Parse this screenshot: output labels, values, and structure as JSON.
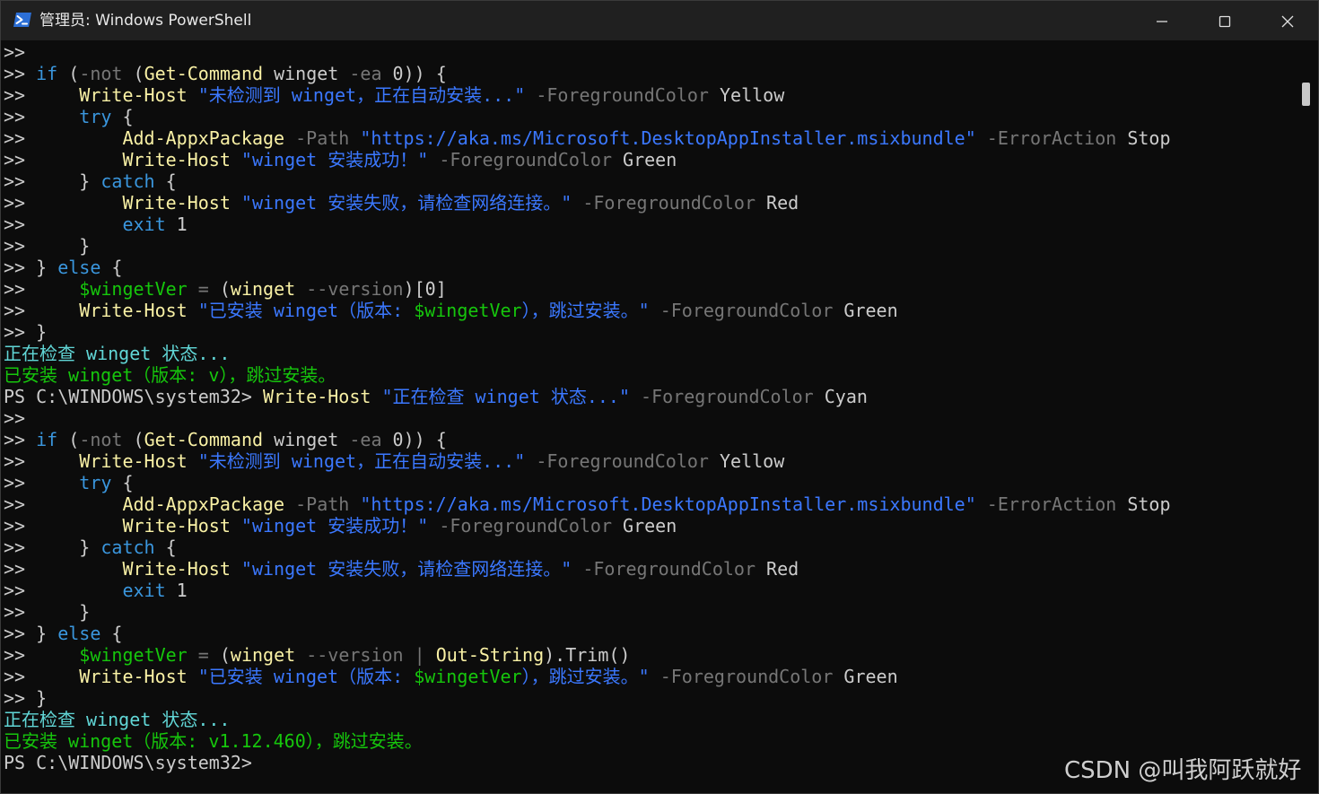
{
  "window": {
    "title": "管理员: Windows PowerShell",
    "app_icon": "powershell-icon",
    "controls": [
      "minimize-icon",
      "maximize-icon",
      "close-icon"
    ]
  },
  "colors": {
    "background": "#0c0c0c",
    "titlebar": "#202020",
    "command": "#f9f1a5",
    "keyword": "#3a96dd",
    "string": "#3b78ff",
    "parameter": "#767676",
    "variable": "#16c60c",
    "text": "#cccccc",
    "output_cyan": "#61d6d6",
    "output_green": "#16c60c"
  },
  "terminal": {
    "lines": [
      [
        [
          "text",
          ">>"
        ]
      ],
      [
        [
          "text",
          ">> "
        ],
        [
          "keyword",
          "if"
        ],
        [
          "text",
          " ("
        ],
        [
          "operator",
          "-not"
        ],
        [
          "text",
          " ("
        ],
        [
          "command",
          "Get-Command"
        ],
        [
          "text",
          " winget "
        ],
        [
          "param",
          "-ea"
        ],
        [
          "text",
          " 0)) {"
        ]
      ],
      [
        [
          "text",
          ">>     "
        ],
        [
          "command",
          "Write-Host"
        ],
        [
          "text",
          " "
        ],
        [
          "string",
          "\"未检测到 winget，正在自动安装...\""
        ],
        [
          "text",
          " "
        ],
        [
          "param",
          "-ForegroundColor"
        ],
        [
          "text",
          " Yellow"
        ]
      ],
      [
        [
          "text",
          ">>     "
        ],
        [
          "keyword",
          "try"
        ],
        [
          "text",
          " {"
        ]
      ],
      [
        [
          "text",
          ">>         "
        ],
        [
          "command",
          "Add-AppxPackage"
        ],
        [
          "text",
          " "
        ],
        [
          "param",
          "-Path"
        ],
        [
          "text",
          " "
        ],
        [
          "string",
          "\"https://aka.ms/Microsoft.DesktopAppInstaller.msixbundle\""
        ],
        [
          "text",
          " "
        ],
        [
          "param",
          "-ErrorAction"
        ],
        [
          "text",
          " Stop"
        ]
      ],
      [
        [
          "text",
          ">>         "
        ],
        [
          "command",
          "Write-Host"
        ],
        [
          "text",
          " "
        ],
        [
          "string",
          "\"winget 安装成功！\""
        ],
        [
          "text",
          " "
        ],
        [
          "param",
          "-ForegroundColor"
        ],
        [
          "text",
          " Green"
        ]
      ],
      [
        [
          "text",
          ">>     } "
        ],
        [
          "keyword",
          "catch"
        ],
        [
          "text",
          " {"
        ]
      ],
      [
        [
          "text",
          ">>         "
        ],
        [
          "command",
          "Write-Host"
        ],
        [
          "text",
          " "
        ],
        [
          "string",
          "\"winget 安装失败，请检查网络连接。\""
        ],
        [
          "text",
          " "
        ],
        [
          "param",
          "-ForegroundColor"
        ],
        [
          "text",
          " Red"
        ]
      ],
      [
        [
          "text",
          ">>         "
        ],
        [
          "keyword",
          "exit"
        ],
        [
          "text",
          " 1"
        ]
      ],
      [
        [
          "text",
          ">>     }"
        ]
      ],
      [
        [
          "text",
          ">> } "
        ],
        [
          "keyword",
          "else"
        ],
        [
          "text",
          " {"
        ]
      ],
      [
        [
          "text",
          ">>     "
        ],
        [
          "variable",
          "$wingetVer"
        ],
        [
          "text",
          " "
        ],
        [
          "operator",
          "="
        ],
        [
          "text",
          " ("
        ],
        [
          "command",
          "winget"
        ],
        [
          "text",
          " "
        ],
        [
          "param",
          "--version"
        ],
        [
          "text",
          ")[0]"
        ]
      ],
      [
        [
          "text",
          ">>     "
        ],
        [
          "command",
          "Write-Host"
        ],
        [
          "text",
          " "
        ],
        [
          "string",
          "\"已安装 winget（版本: "
        ],
        [
          "variable",
          "$wingetVer"
        ],
        [
          "string",
          "），跳过安装。\""
        ],
        [
          "text",
          " "
        ],
        [
          "param",
          "-ForegroundColor"
        ],
        [
          "text",
          " Green"
        ]
      ],
      [
        [
          "text",
          ">> }"
        ]
      ],
      [
        [
          "outcyan",
          "正在检查 winget 状态..."
        ]
      ],
      [
        [
          "outgreen",
          "已安装 winget（版本: v），跳过安装。"
        ]
      ],
      [
        [
          "text",
          "PS C:\\WINDOWS\\system32> "
        ],
        [
          "command",
          "Write-Host"
        ],
        [
          "text",
          " "
        ],
        [
          "string",
          "\"正在检查 winget 状态...\""
        ],
        [
          "text",
          " "
        ],
        [
          "param",
          "-ForegroundColor"
        ],
        [
          "text",
          " Cyan"
        ]
      ],
      [
        [
          "text",
          ">>"
        ]
      ],
      [
        [
          "text",
          ">> "
        ],
        [
          "keyword",
          "if"
        ],
        [
          "text",
          " ("
        ],
        [
          "operator",
          "-not"
        ],
        [
          "text",
          " ("
        ],
        [
          "command",
          "Get-Command"
        ],
        [
          "text",
          " winget "
        ],
        [
          "param",
          "-ea"
        ],
        [
          "text",
          " 0)) {"
        ]
      ],
      [
        [
          "text",
          ">>     "
        ],
        [
          "command",
          "Write-Host"
        ],
        [
          "text",
          " "
        ],
        [
          "string",
          "\"未检测到 winget，正在自动安装...\""
        ],
        [
          "text",
          " "
        ],
        [
          "param",
          "-ForegroundColor"
        ],
        [
          "text",
          " Yellow"
        ]
      ],
      [
        [
          "text",
          ">>     "
        ],
        [
          "keyword",
          "try"
        ],
        [
          "text",
          " {"
        ]
      ],
      [
        [
          "text",
          ">>         "
        ],
        [
          "command",
          "Add-AppxPackage"
        ],
        [
          "text",
          " "
        ],
        [
          "param",
          "-Path"
        ],
        [
          "text",
          " "
        ],
        [
          "string",
          "\"https://aka.ms/Microsoft.DesktopAppInstaller.msixbundle\""
        ],
        [
          "text",
          " "
        ],
        [
          "param",
          "-ErrorAction"
        ],
        [
          "text",
          " Stop"
        ]
      ],
      [
        [
          "text",
          ">>         "
        ],
        [
          "command",
          "Write-Host"
        ],
        [
          "text",
          " "
        ],
        [
          "string",
          "\"winget 安装成功！\""
        ],
        [
          "text",
          " "
        ],
        [
          "param",
          "-ForegroundColor"
        ],
        [
          "text",
          " Green"
        ]
      ],
      [
        [
          "text",
          ">>     } "
        ],
        [
          "keyword",
          "catch"
        ],
        [
          "text",
          " {"
        ]
      ],
      [
        [
          "text",
          ">>         "
        ],
        [
          "command",
          "Write-Host"
        ],
        [
          "text",
          " "
        ],
        [
          "string",
          "\"winget 安装失败，请检查网络连接。\""
        ],
        [
          "text",
          " "
        ],
        [
          "param",
          "-ForegroundColor"
        ],
        [
          "text",
          " Red"
        ]
      ],
      [
        [
          "text",
          ">>         "
        ],
        [
          "keyword",
          "exit"
        ],
        [
          "text",
          " 1"
        ]
      ],
      [
        [
          "text",
          ">>     }"
        ]
      ],
      [
        [
          "text",
          ">> } "
        ],
        [
          "keyword",
          "else"
        ],
        [
          "text",
          " {"
        ]
      ],
      [
        [
          "text",
          ">>     "
        ],
        [
          "variable",
          "$wingetVer"
        ],
        [
          "text",
          " "
        ],
        [
          "operator",
          "="
        ],
        [
          "text",
          " ("
        ],
        [
          "command",
          "winget"
        ],
        [
          "text",
          " "
        ],
        [
          "param",
          "--version"
        ],
        [
          "text",
          " "
        ],
        [
          "operator",
          "|"
        ],
        [
          "text",
          " "
        ],
        [
          "command",
          "Out-String"
        ],
        [
          "text",
          ").Trim()"
        ]
      ],
      [
        [
          "text",
          ">>     "
        ],
        [
          "command",
          "Write-Host"
        ],
        [
          "text",
          " "
        ],
        [
          "string",
          "\"已安装 winget（版本: "
        ],
        [
          "variable",
          "$wingetVer"
        ],
        [
          "string",
          "），跳过安装。\""
        ],
        [
          "text",
          " "
        ],
        [
          "param",
          "-ForegroundColor"
        ],
        [
          "text",
          " Green"
        ]
      ],
      [
        [
          "text",
          ">> }"
        ]
      ],
      [
        [
          "outcyan",
          "正在检查 winget 状态..."
        ]
      ],
      [
        [
          "outgreen",
          "已安装 winget（版本: v1.12.460），跳过安装。"
        ]
      ],
      [
        [
          "text",
          "PS C:\\WINDOWS\\system32>"
        ]
      ]
    ]
  },
  "watermark": "CSDN @叫我阿跃就好"
}
